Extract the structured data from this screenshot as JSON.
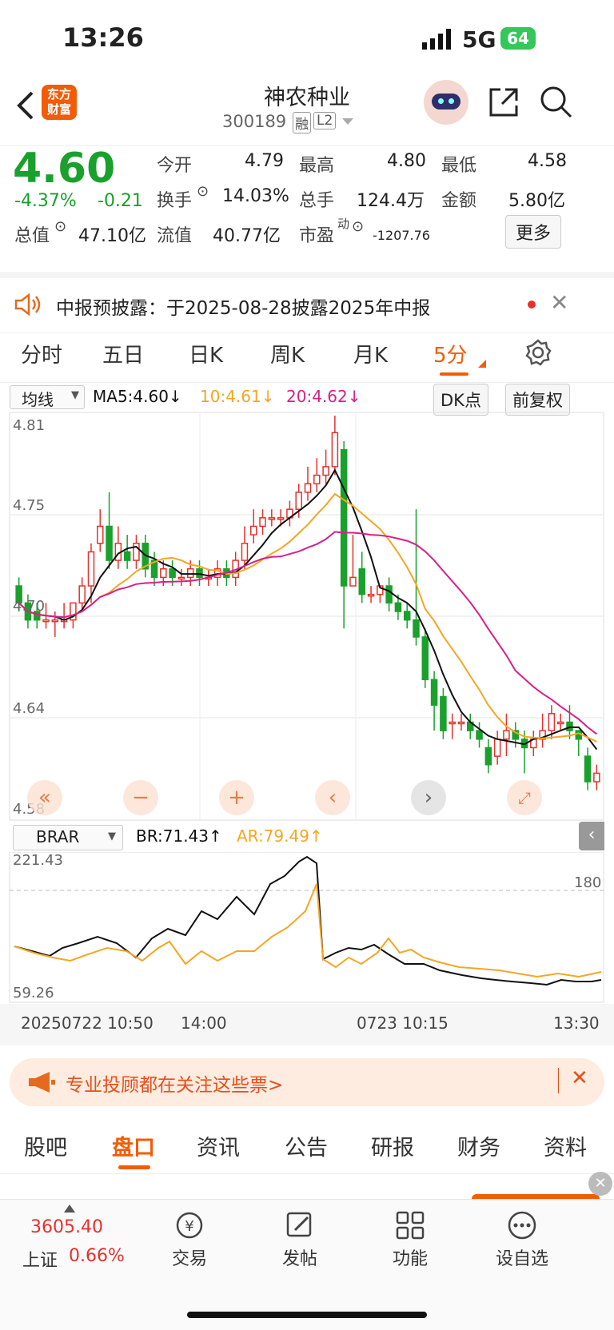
{
  "status": {
    "time": "13:26",
    "network": "5G",
    "battery": "64"
  },
  "nav": {
    "title": "神农种业",
    "code": "300189",
    "tag_rong": "融",
    "tag_l2": "L2",
    "logo_line1": "东方",
    "logo_line2": "财富"
  },
  "quote": {
    "price": "4.60",
    "change_pct": "-4.37%",
    "change_amt": "-0.21",
    "open_label": "今开",
    "open": "4.79",
    "high_label": "最高",
    "high": "4.80",
    "low_label": "最低",
    "low": "4.58",
    "turnover_label": "换手",
    "turnover": "14.03%",
    "volume_label": "总手",
    "volume": "124.4万",
    "amount_label": "金额",
    "amount": "5.80亿",
    "mktcap_label": "总值",
    "mktcap": "47.10亿",
    "float_label": "流值",
    "float_cap": "40.77亿",
    "pe_label": "市盈",
    "pe_sup": "动",
    "pe": "-1207.76",
    "more_label": "更多"
  },
  "notice": {
    "text": "中报预披露：于2025-08-28披露2025年中报"
  },
  "ktabs": [
    "分时",
    "五日",
    "日K",
    "周K",
    "月K",
    "5分"
  ],
  "main_chart": {
    "indicator_label": "均线",
    "ma5": "MA5:4.60↓",
    "ma10": "10:4.61↓",
    "ma20": "20:4.62↓",
    "dk_label": "DK点",
    "fuquan_label": "前复权",
    "y_labels": [
      "4.81",
      "4.75",
      "4.70",
      "4.64",
      "4.58"
    ]
  },
  "sub_chart": {
    "indicator_label": "BRAR",
    "br": "BR:71.43↑",
    "ar": "AR:79.49↑",
    "y_top": "221.43",
    "y_ref": "180",
    "y_bottom": "59.26"
  },
  "x_axis": [
    "20250722 10:50",
    "14:00",
    "0723 10:15",
    "13:30"
  ],
  "chart_data": {
    "type": "candlestick",
    "y_range": [
      4.58,
      4.81
    ],
    "candles": [
      [
        4.71,
        4.7,
        4.715,
        4.695
      ],
      [
        4.7,
        4.69,
        4.705,
        4.685
      ],
      [
        4.695,
        4.69,
        4.7,
        4.685
      ],
      [
        4.69,
        4.69,
        4.7,
        4.685
      ],
      [
        4.69,
        4.69,
        4.695,
        4.68
      ],
      [
        4.69,
        4.69,
        4.7,
        4.685
      ],
      [
        4.69,
        4.7,
        4.7,
        4.685
      ],
      [
        4.7,
        4.71,
        4.715,
        4.695
      ],
      [
        4.71,
        4.73,
        4.735,
        4.7
      ],
      [
        4.735,
        4.745,
        4.755,
        4.73
      ],
      [
        4.745,
        4.725,
        4.765,
        4.72
      ],
      [
        4.725,
        4.735,
        4.745,
        4.72
      ],
      [
        4.73,
        4.725,
        4.74,
        4.72
      ],
      [
        4.725,
        4.735,
        4.74,
        4.72
      ],
      [
        4.735,
        4.72,
        4.74,
        4.715
      ],
      [
        4.725,
        4.715,
        4.73,
        4.71
      ],
      [
        4.715,
        4.72,
        4.725,
        4.71
      ],
      [
        4.72,
        4.715,
        4.725,
        4.71
      ],
      [
        4.715,
        4.715,
        4.72,
        4.71
      ],
      [
        4.715,
        4.72,
        4.725,
        4.71
      ],
      [
        4.72,
        4.715,
        4.725,
        4.71
      ],
      [
        4.715,
        4.715,
        4.72,
        4.71
      ],
      [
        4.715,
        4.72,
        4.725,
        4.71
      ],
      [
        4.72,
        4.715,
        4.725,
        4.71
      ],
      [
        4.715,
        4.725,
        4.73,
        4.71
      ],
      [
        4.725,
        4.735,
        4.745,
        4.72
      ],
      [
        4.74,
        4.745,
        4.755,
        4.735
      ],
      [
        4.745,
        4.75,
        4.755,
        4.74
      ],
      [
        4.75,
        4.75,
        4.755,
        4.745
      ],
      [
        4.75,
        4.75,
        4.755,
        4.745
      ],
      [
        4.75,
        4.755,
        4.76,
        4.745
      ],
      [
        4.755,
        4.765,
        4.77,
        4.75
      ],
      [
        4.765,
        4.77,
        4.78,
        4.76
      ],
      [
        4.77,
        4.775,
        4.785,
        4.765
      ],
      [
        4.775,
        4.78,
        4.79,
        4.77
      ],
      [
        4.78,
        4.8,
        4.81,
        4.775
      ],
      [
        4.79,
        4.71,
        4.795,
        4.685
      ],
      [
        4.71,
        4.715,
        4.74,
        4.71
      ],
      [
        4.72,
        4.705,
        4.73,
        4.7
      ],
      [
        4.705,
        4.705,
        4.71,
        4.7
      ],
      [
        4.705,
        4.71,
        4.71,
        4.7
      ],
      [
        4.71,
        4.7,
        4.715,
        4.695
      ],
      [
        4.7,
        4.695,
        4.705,
        4.69
      ],
      [
        4.695,
        4.69,
        4.7,
        4.685
      ],
      [
        4.69,
        4.68,
        4.755,
        4.675
      ],
      [
        4.68,
        4.655,
        4.685,
        4.65
      ],
      [
        4.655,
        4.64,
        4.66,
        4.625
      ],
      [
        4.645,
        4.625,
        4.65,
        4.62
      ],
      [
        4.63,
        4.63,
        4.635,
        4.62
      ],
      [
        4.63,
        4.63,
        4.635,
        4.625
      ],
      [
        4.63,
        4.625,
        4.635,
        4.62
      ],
      [
        4.625,
        4.62,
        4.63,
        4.615
      ],
      [
        4.615,
        4.605,
        4.62,
        4.6
      ],
      [
        4.61,
        4.62,
        4.625,
        4.605
      ],
      [
        4.62,
        4.625,
        4.635,
        4.61
      ],
      [
        4.625,
        4.62,
        4.63,
        4.615
      ],
      [
        4.62,
        4.615,
        4.625,
        4.6
      ],
      [
        4.615,
        4.62,
        4.625,
        4.61
      ],
      [
        4.62,
        4.625,
        4.635,
        4.615
      ],
      [
        4.625,
        4.635,
        4.64,
        4.62
      ],
      [
        4.63,
        4.63,
        4.635,
        4.625
      ],
      [
        4.63,
        4.625,
        4.64,
        4.62
      ],
      [
        4.625,
        4.62,
        4.625,
        4.61
      ],
      [
        4.61,
        4.595,
        4.615,
        4.59
      ],
      [
        4.595,
        4.6,
        4.605,
        4.59
      ]
    ]
  },
  "banner": {
    "text": "专业投顾都在关注这些票>"
  },
  "tabs2": [
    "股吧",
    "盘口",
    "资讯",
    "公告",
    "研报",
    "财务",
    "资料"
  ],
  "bottom": {
    "index_value": "3605.40",
    "index_name": "上证",
    "index_pct": "0.66%",
    "trade": "交易",
    "post": "发帖",
    "func": "功能",
    "watch": "设自选"
  }
}
